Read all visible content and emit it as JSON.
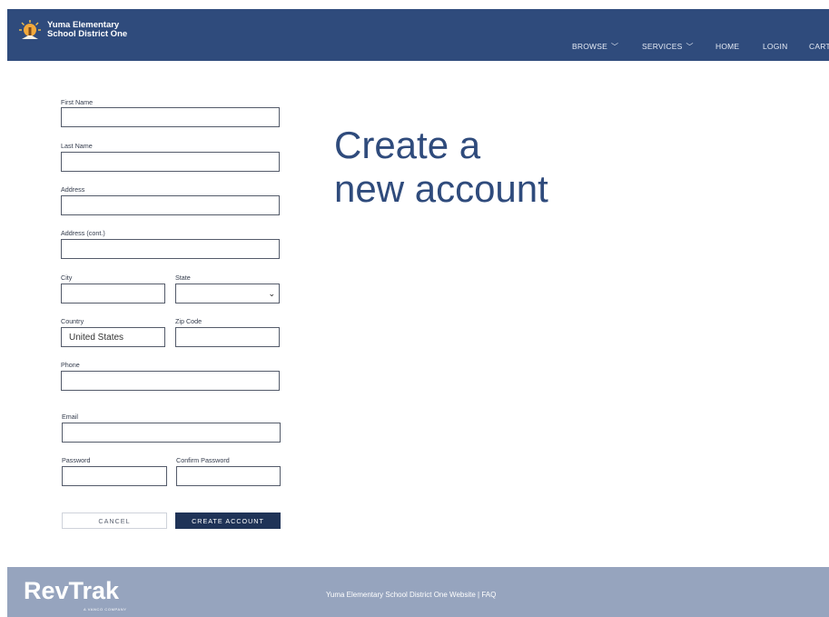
{
  "header": {
    "brand_line1": "Yuma Elementary",
    "brand_line2": "School District One",
    "nav": [
      {
        "label": "BROWSE",
        "icon": "chevron-down-icon"
      },
      {
        "label": "SERVICES",
        "icon": "chevron-down-icon"
      },
      {
        "label": "HOME"
      },
      {
        "label": "LOGIN"
      },
      {
        "label": "CART"
      }
    ]
  },
  "form": {
    "first_name_label": "First Name",
    "last_name_label": "Last Name",
    "address_label": "Address",
    "address2_label": "Address (cont.)",
    "city_label": "City",
    "state_label": "State",
    "country_label": "Country",
    "country_value": "United States",
    "zip_label": "Zip Code",
    "phone_label": "Phone",
    "email_label": "Email",
    "password_label": "Password",
    "confirm_password_label": "Confirm Password",
    "cancel_label": "CANCEL",
    "create_label": "CREATE ACCOUNT"
  },
  "headline": {
    "line1": "Create a",
    "line2": "new account"
  },
  "footer": {
    "logo_text": "RevTrak",
    "logo_sub": "A VANCO COMPANY",
    "links": "Yuma Elementary School District One Website | FAQ"
  },
  "colors": {
    "header_bg": "#2f4b7c",
    "footer_bg": "#96a4be",
    "primary_button": "#1f3357"
  }
}
